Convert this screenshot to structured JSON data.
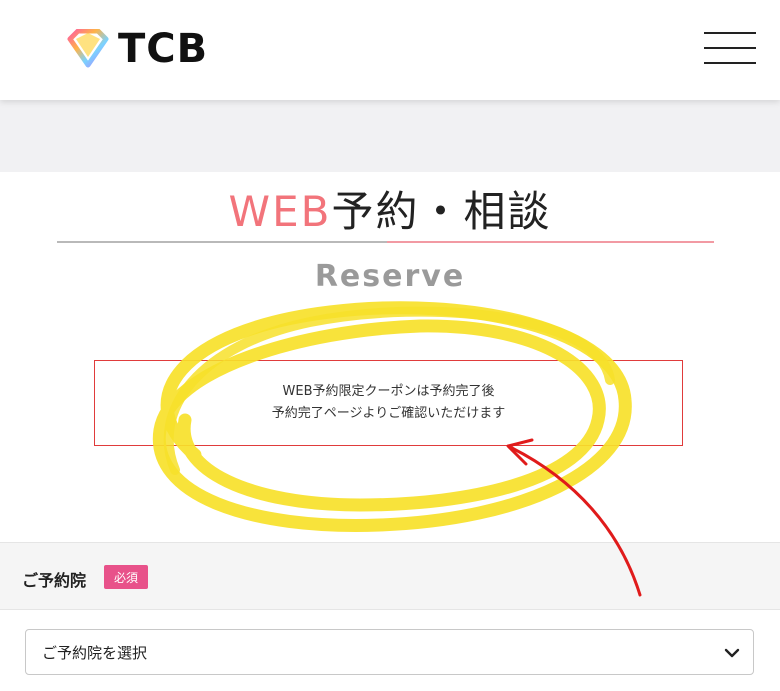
{
  "header": {
    "logo_text": "TCB",
    "logo_icon": "diamond-icon",
    "menu_icon": "hamburger-icon"
  },
  "page": {
    "title_accent": "WEB",
    "title_rest": "予約・相談",
    "subtitle": "Reserve",
    "accent_color": "#f2747b"
  },
  "notice": {
    "line1": "WEB予約限定クーポンは予約完了後",
    "line2": "予約完了ページよりご確認いただけます"
  },
  "form": {
    "clinic_label": "ご予約院",
    "required_badge": "必須",
    "clinic_select_value": "ご予約院を選択",
    "select_icon": "chevron-down-icon"
  }
}
